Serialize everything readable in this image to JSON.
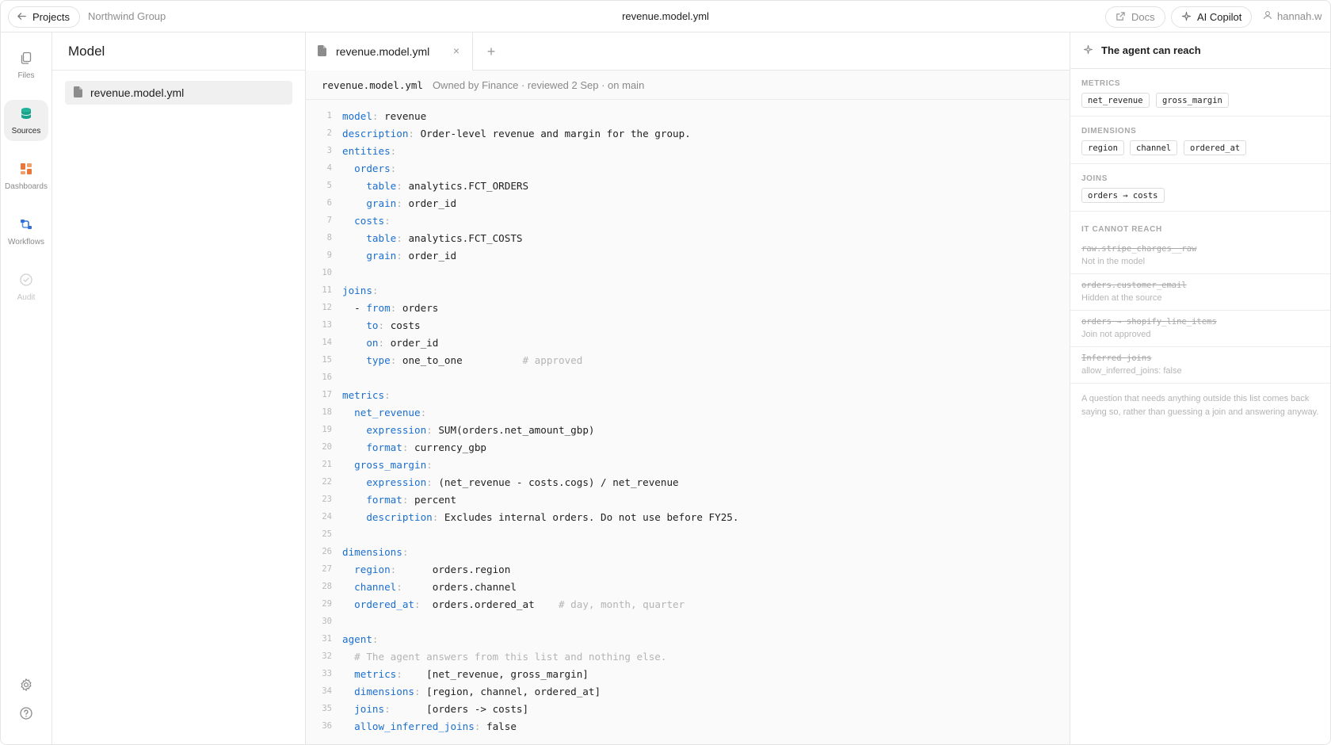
{
  "topbar": {
    "back_label": "Projects",
    "breadcrumb": "Northwind Group",
    "title": "revenue.model.yml",
    "docs_label": "Docs",
    "copilot_label": "AI Copilot",
    "user": "hannah.w"
  },
  "rail": {
    "items": [
      {
        "label": "Files",
        "icon": "files-icon"
      },
      {
        "label": "Sources",
        "icon": "database-icon"
      },
      {
        "label": "Dashboards",
        "icon": "dashboard-icon"
      },
      {
        "label": "Workflows",
        "icon": "workflow-icon"
      },
      {
        "label": "Audit",
        "icon": "check-circle-icon"
      }
    ],
    "active": "Sources",
    "bottom_icons": [
      "gear-icon",
      "help-icon"
    ]
  },
  "explorer": {
    "title": "Model",
    "files": [
      "revenue.model.yml"
    ]
  },
  "editor": {
    "tab_label": "revenue.model.yml",
    "file_name": "revenue.model.yml",
    "file_meta": "Owned by Finance · reviewed 2 Sep · on main",
    "lines": [
      {
        "n": "1"
      },
      {
        "n": "2"
      },
      {
        "n": "3"
      },
      {
        "n": "4"
      },
      {
        "n": "5"
      },
      {
        "n": "6"
      },
      {
        "n": "7"
      },
      {
        "n": "8"
      },
      {
        "n": "9"
      },
      {
        "n": "10"
      },
      {
        "n": "11"
      },
      {
        "n": "12"
      },
      {
        "n": "13"
      },
      {
        "n": "14"
      },
      {
        "n": "15"
      },
      {
        "n": "16"
      },
      {
        "n": "17"
      },
      {
        "n": "18"
      },
      {
        "n": "19"
      },
      {
        "n": "20"
      },
      {
        "n": "21"
      },
      {
        "n": "22"
      },
      {
        "n": "23"
      },
      {
        "n": "24"
      },
      {
        "n": "25"
      },
      {
        "n": "26"
      },
      {
        "n": "27"
      },
      {
        "n": "28"
      },
      {
        "n": "29"
      },
      {
        "n": "30"
      },
      {
        "n": "31"
      },
      {
        "n": "32"
      },
      {
        "n": "33"
      },
      {
        "n": "34"
      },
      {
        "n": "35"
      },
      {
        "n": "36"
      }
    ],
    "code": {
      "l1k": "model",
      "l1v": "revenue",
      "l2k": "description",
      "l2v": "Order-level revenue and margin for the group.",
      "l3k": "entities",
      "l4k": "orders",
      "l5k": "table",
      "l5v": "analytics.FCT_ORDERS",
      "l6k": "grain",
      "l6v": "order_id",
      "l7k": "costs",
      "l8k": "table",
      "l8v": "analytics.FCT_COSTS",
      "l9k": "grain",
      "l9v": "order_id",
      "l11k": "joins",
      "l12k": "from",
      "l12v": "orders",
      "l13k": "to",
      "l13v": "costs",
      "l14k": "on",
      "l14v": "order_id",
      "l15k": "type",
      "l15v": "one_to_one",
      "l15c": "# approved",
      "l17k": "metrics",
      "l18k": "net_revenue",
      "l19k": "expression",
      "l19v": "SUM(orders.net_amount_gbp)",
      "l20k": "format",
      "l20v": "currency_gbp",
      "l21k": "gross_margin",
      "l22k": "expression",
      "l22v": "(net_revenue - costs.cogs) / net_revenue",
      "l23k": "format",
      "l23v": "percent",
      "l24k": "description",
      "l24v": "Excludes internal orders. Do not use before FY25.",
      "l26k": "dimensions",
      "l27k": "region",
      "l27v": "orders.region",
      "l28k": "channel",
      "l28v": "orders.channel",
      "l29k": "ordered_at",
      "l29v": "orders.ordered_at",
      "l29c": "# day, month, quarter",
      "l31k": "agent",
      "l32c": "# The agent answers from this list and nothing else.",
      "l33k": "metrics",
      "l33v": "[net_revenue, gross_margin]",
      "l34k": "dimensions",
      "l34v": "[region, channel, ordered_at]",
      "l35k": "joins",
      "l35v": "[orders -> costs]",
      "l36k": "allow_inferred_joins",
      "l36v": "false"
    }
  },
  "panel": {
    "title": "The agent can reach",
    "metrics_title": "METRICS",
    "metrics": [
      "net_revenue",
      "gross_margin"
    ],
    "dimensions_title": "DIMENSIONS",
    "dimensions": [
      "region",
      "channel",
      "ordered_at"
    ],
    "joins_title": "JOINS",
    "joins": [
      "orders → costs"
    ],
    "cannot_title": "IT CANNOT REACH",
    "cannot": [
      {
        "name": "raw.stripe_charges__raw",
        "reason": "Not in the model"
      },
      {
        "name": "orders.customer_email",
        "reason": "Hidden at the source"
      },
      {
        "name": "orders → shopify_line_items",
        "reason": "Join not approved"
      },
      {
        "name": "Inferred joins",
        "reason": "allow_inferred_joins: false"
      }
    ],
    "note": "A question that needs anything outside this list comes back saying so, rather than guessing a join and answering anyway."
  },
  "colors": {
    "key_blue": "#1b6fd0",
    "sources_icon": "#1fb39a",
    "dashboards_icon": "#e8773a",
    "workflows_icon": "#2f6fd6"
  }
}
